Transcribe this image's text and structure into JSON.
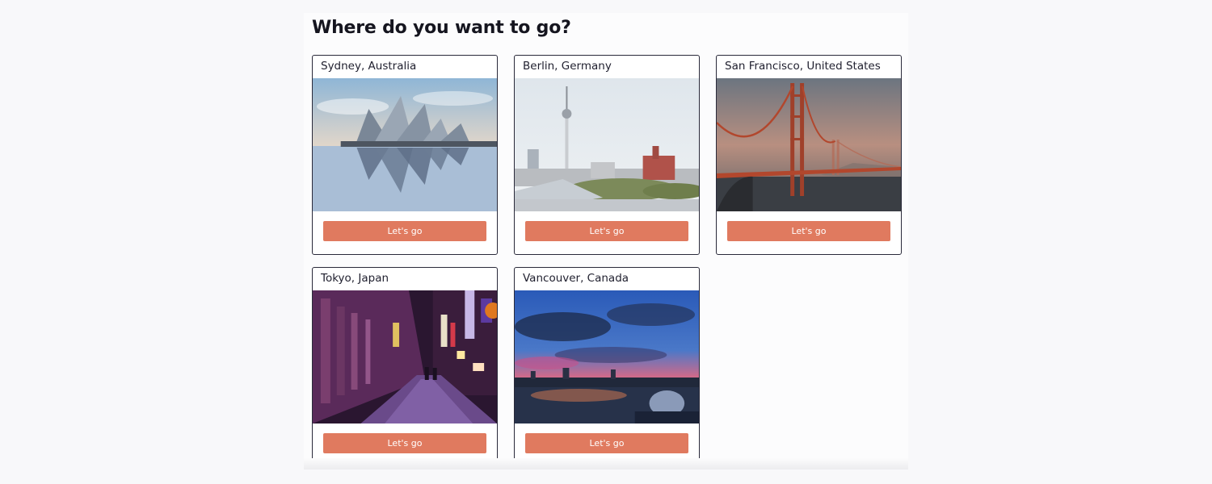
{
  "page": {
    "heading": "Where do you want to go?"
  },
  "button_color": "#e07a5f",
  "destinations": [
    {
      "title": "Sydney, Australia",
      "image": "sydney-opera-house-photo",
      "button_label": "Let's go"
    },
    {
      "title": "Berlin, Germany",
      "image": "berlin-tv-tower-photo",
      "button_label": "Let's go"
    },
    {
      "title": "San Francisco, United States",
      "image": "golden-gate-bridge-photo",
      "button_label": "Let's go"
    },
    {
      "title": "Tokyo, Japan",
      "image": "tokyo-night-street-photo",
      "button_label": "Let's go"
    },
    {
      "title": "Vancouver, Canada",
      "image": "vancouver-sunset-skyline-photo",
      "button_label": "Let's go"
    }
  ]
}
